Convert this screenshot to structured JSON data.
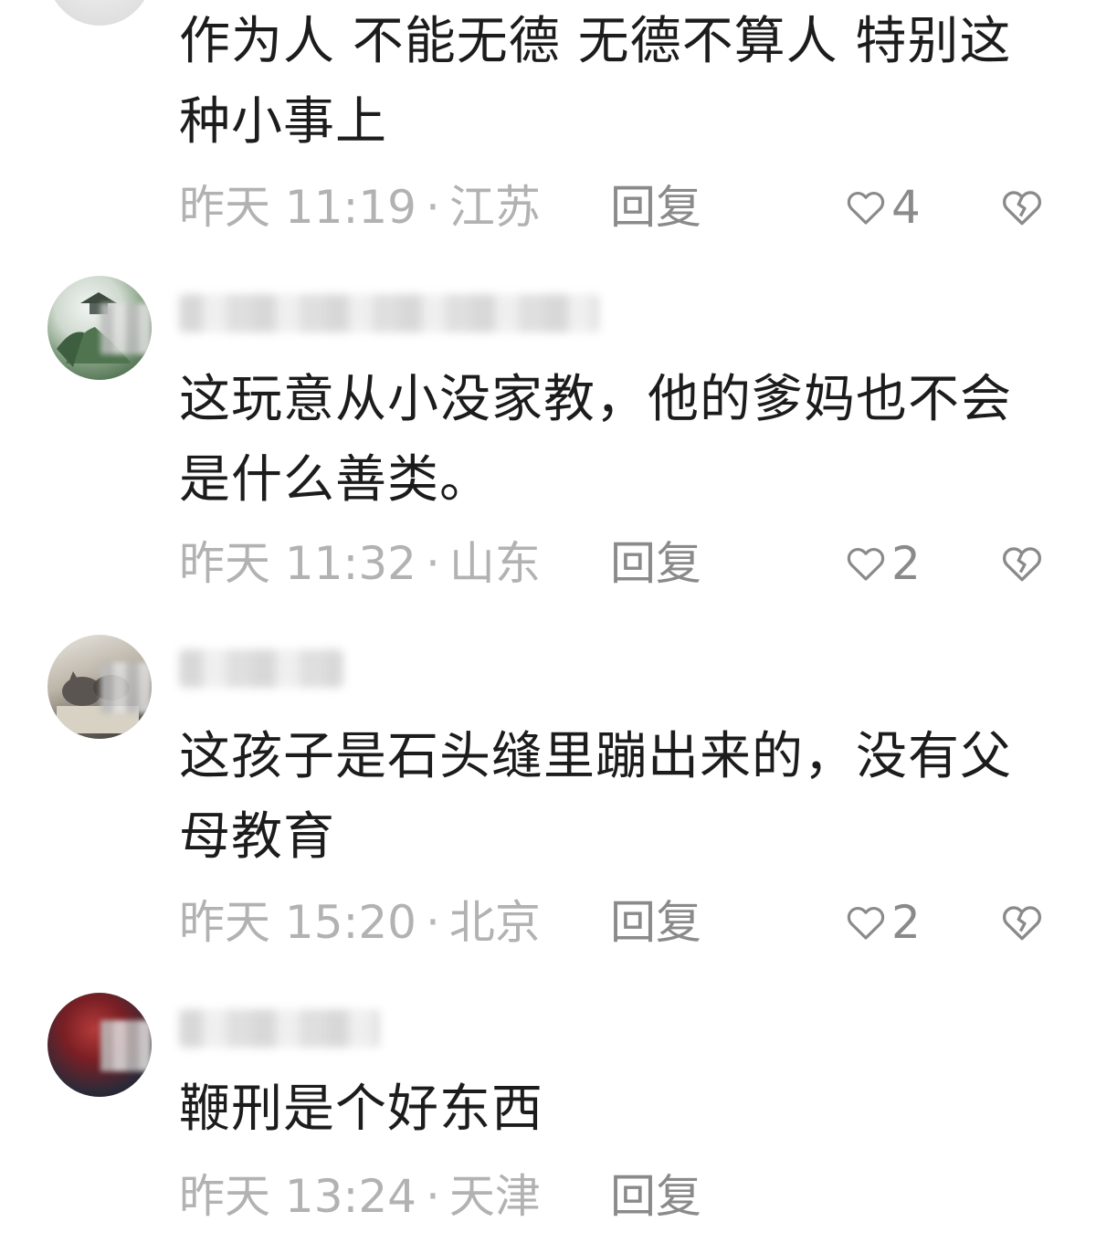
{
  "comments": [
    {
      "text": "作为人 不能无德 无德不算人 特别这种小事上",
      "time": "昨天 11:19",
      "location": "江苏",
      "reply_label": "回复",
      "likes": "4",
      "avatar_icon": "avatar-partial"
    },
    {
      "text": "这玩意从小没家教，他的爹妈也不会是什么善类。",
      "time": "昨天 11:32",
      "location": "山东",
      "reply_label": "回复",
      "likes": "2",
      "avatar_icon": "landscape-pavilion"
    },
    {
      "text": "这孩子是石头缝里蹦出来的，没有父母教育",
      "time": "昨天 15:20",
      "location": "北京",
      "reply_label": "回复",
      "likes": "2",
      "avatar_icon": "cats-photo"
    },
    {
      "text": "鞭刑是个好东西",
      "time": "昨天 13:24",
      "location": "天津",
      "reply_label": "回复",
      "avatar_icon": "dark-portrait"
    }
  ],
  "meta_separator": "·",
  "colors": {
    "text": "#1c1c1c",
    "meta": "#b2b2b2",
    "action": "#8a8a8a"
  }
}
